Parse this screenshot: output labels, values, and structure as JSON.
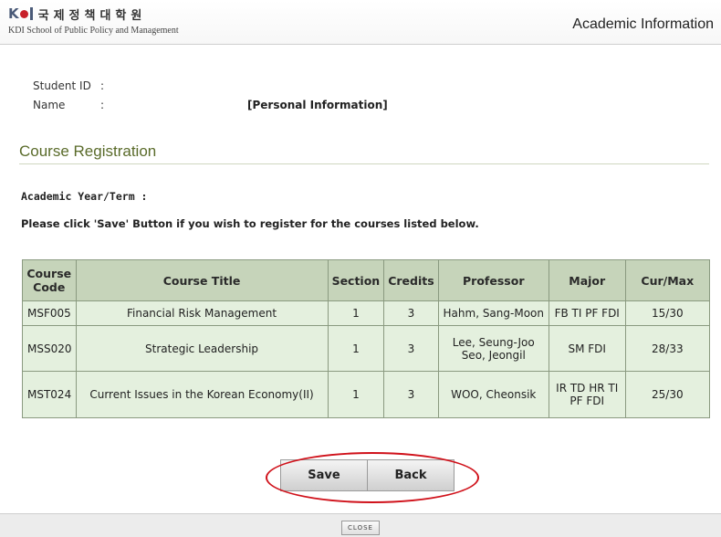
{
  "header": {
    "logo_mark": "K",
    "logo_korean": "국제정책대학원",
    "logo_english": "KDI School of Public Policy and Management",
    "title": "Academic Information"
  },
  "student": {
    "id_label": "Student ID",
    "name_label": "Name",
    "colon": ":",
    "personal_info": "[Personal Information]"
  },
  "section": {
    "title": "Course Registration",
    "term_label": "Academic Year/Term :",
    "notice": "Please click 'Save' Button if you wish to register for the courses listed below."
  },
  "table": {
    "headers": {
      "code_line1": "Course",
      "code_line2": "Code",
      "title": "Course Title",
      "section": "Section",
      "credits": "Credits",
      "professor": "Professor",
      "major": "Major",
      "curmax": "Cur/Max"
    },
    "rows": [
      {
        "code": "MSF005",
        "title": "Financial Risk Management",
        "section": "1",
        "credits": "3",
        "professor_line1": "Hahm, Sang-Moon",
        "professor_line2": "",
        "major_line1": "FB TI PF FDI",
        "major_line2": "",
        "curmax": "15/30"
      },
      {
        "code": "MSS020",
        "title": "Strategic Leadership",
        "section": "1",
        "credits": "3",
        "professor_line1": "Lee, Seung-Joo",
        "professor_line2": "Seo, Jeongil",
        "major_line1": "SM FDI",
        "major_line2": "",
        "curmax": "28/33"
      },
      {
        "code": "MST024",
        "title": "Current Issues in the Korean Economy(II)",
        "section": "1",
        "credits": "3",
        "professor_line1": "WOO, Cheonsik",
        "professor_line2": "",
        "major_line1": "IR TD HR TI",
        "major_line2": "PF FDI",
        "curmax": "25/30"
      }
    ]
  },
  "buttons": {
    "save": "Save",
    "back": "Back"
  },
  "footer": {
    "close": "CLOSE"
  },
  "colors": {
    "header_row": "#c6d4ba",
    "body_row": "#e4f0de",
    "section_title": "#5a6b2a",
    "highlight": "#d0121b"
  }
}
